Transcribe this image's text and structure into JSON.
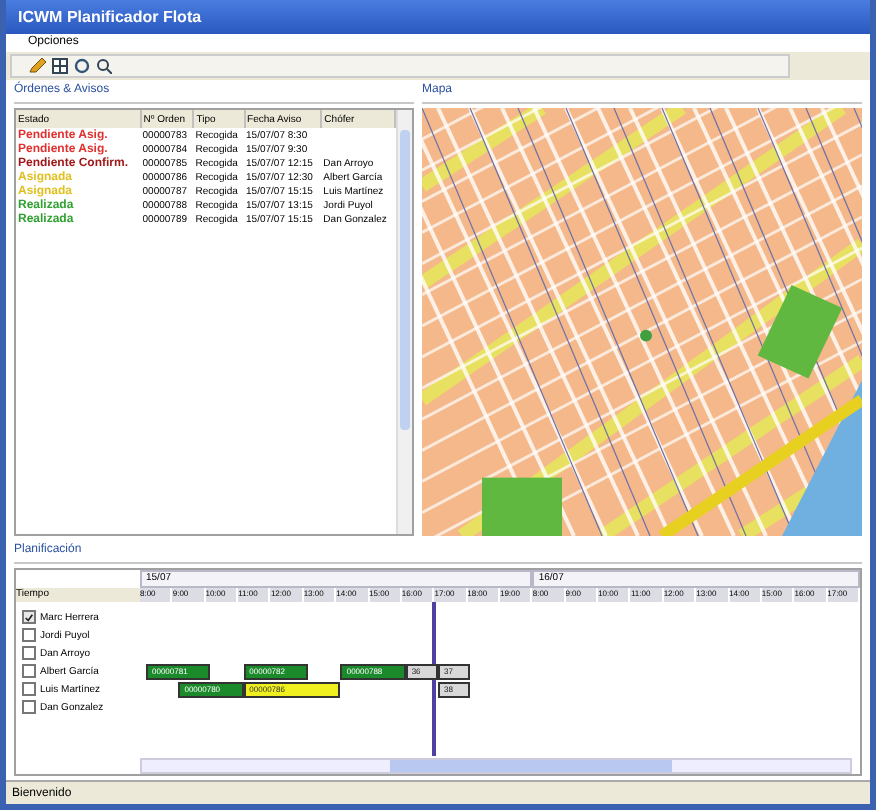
{
  "window": {
    "title": "ICWM Planificador Flota"
  },
  "menu": [
    "Opciones"
  ],
  "orders": {
    "title": "Órdenes & Avisos",
    "columns": [
      "Estado",
      "Nº Orden",
      "Tipo",
      "Fecha Aviso",
      "Chófer"
    ],
    "rows": [
      {
        "color": "#e03030",
        "cells": [
          "Pendiente Asig.",
          "00000783",
          "Recogida",
          "15/07/07 8:30",
          ""
        ]
      },
      {
        "color": "#e03030",
        "cells": [
          "Pendiente Asig.",
          "00000784",
          "Recogida",
          "15/07/07 9:30",
          ""
        ]
      },
      {
        "color": "#a01818",
        "cells": [
          "Pendiente Confirm.",
          "00000785",
          "Recogida",
          "15/07/07 12:15",
          "Dan Arroyo"
        ]
      },
      {
        "color": "#e0c020",
        "cells": [
          "Asignada",
          "00000786",
          "Recogida",
          "15/07/07 12:30",
          "Albert García"
        ]
      },
      {
        "color": "#e0c020",
        "cells": [
          "Asignada",
          "00000787",
          "Recogida",
          "15/07/07 15:15",
          "Luis Martínez"
        ]
      },
      {
        "color": "#30a030",
        "cells": [
          "Realizada",
          "00000788",
          "Recogida",
          "15/07/07 13:15",
          "Jordi Puyol"
        ]
      },
      {
        "color": "#30a030",
        "cells": [
          "Realizada",
          "00000789",
          "Recogida",
          "15/07/07 15:15",
          "Dan Gonzalez"
        ]
      }
    ]
  },
  "map": {
    "title": "Mapa"
  },
  "planning": {
    "title": "Planificación",
    "time_label": "Tiempo",
    "days": [
      {
        "label": "15/07",
        "ticks": [
          "8:00",
          "9:00",
          "10:00",
          "11:00",
          "12:00",
          "13:00",
          "14:00",
          "15:00",
          "16:00",
          "17:00",
          "18:00",
          "19:00"
        ]
      },
      {
        "label": "16/07",
        "ticks": [
          "8:00",
          "9:00",
          "10:00",
          "11:00",
          "12:00",
          "13:00",
          "14:00",
          "15:00",
          "16:00",
          "17:00"
        ]
      }
    ],
    "drivers": [
      {
        "name": "Marc Herrera",
        "checked": true
      },
      {
        "name": "Jordi Puyol",
        "checked": false
      },
      {
        "name": "Dan Arroyo",
        "checked": false
      },
      {
        "name": "Albert García",
        "checked": false,
        "slots": [
          {
            "kind": "done",
            "label": "00000781"
          },
          {
            "kind": "done"
          },
          {
            "kind": "empty"
          },
          {
            "kind": "done",
            "label": "00000782"
          },
          {
            "kind": "done"
          },
          {
            "kind": "empty"
          },
          {
            "kind": "done",
            "label": "00000788"
          },
          {
            "kind": "done"
          },
          {
            "kind": "planned",
            "label": "36"
          },
          {
            "kind": "planned",
            "label": "37"
          }
        ]
      },
      {
        "name": "Luis Martínez",
        "checked": false,
        "slots": [
          {
            "kind": "empty"
          },
          {
            "kind": "done",
            "label": "00000780"
          },
          {
            "kind": "done"
          },
          {
            "kind": "assigned",
            "label": "00000786"
          },
          {
            "kind": "assigned"
          },
          {
            "kind": "assigned"
          },
          {
            "kind": "empty"
          },
          {
            "kind": "empty"
          },
          {
            "kind": "empty"
          },
          {
            "kind": "planned",
            "label": "38"
          }
        ]
      },
      {
        "name": "Dan Gonzalez",
        "checked": false
      }
    ]
  },
  "status_bar": "Bienvenido"
}
